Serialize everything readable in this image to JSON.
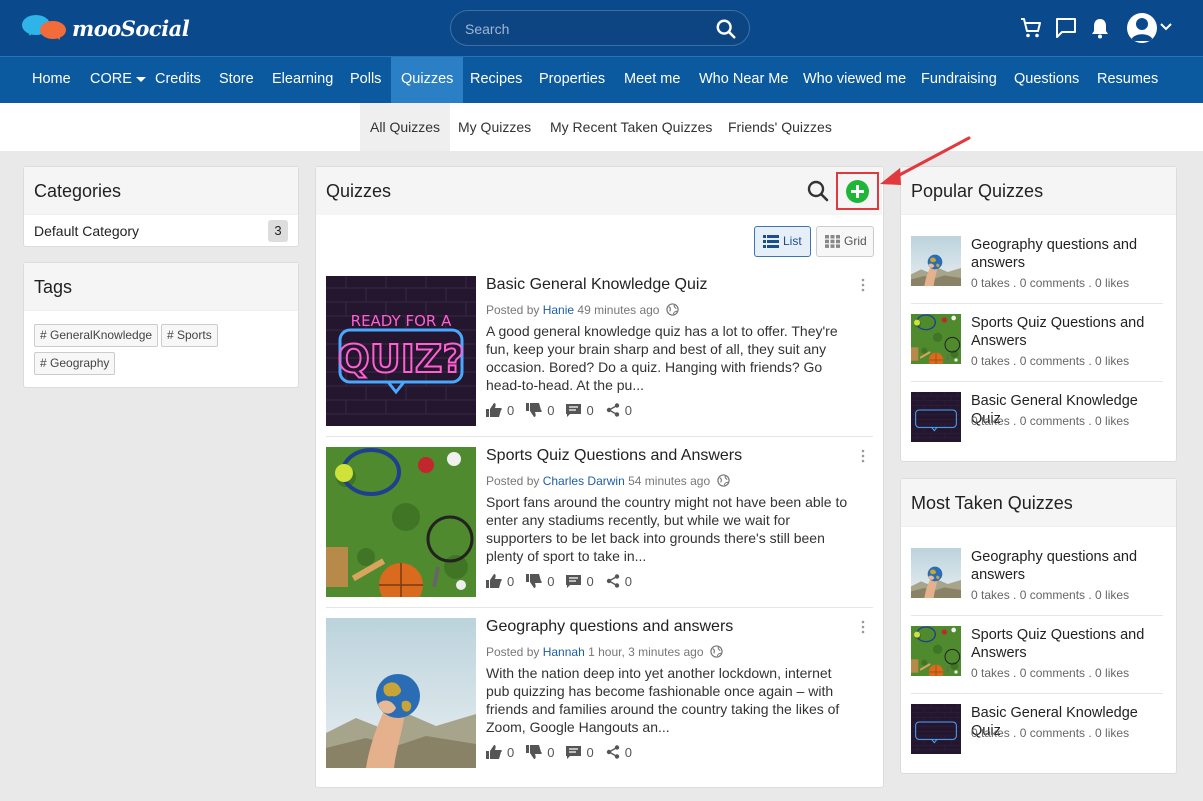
{
  "header": {
    "logo_text": "mooSocial",
    "search_placeholder": "Search"
  },
  "nav": {
    "items": [
      "Home",
      "CORE",
      "Credits",
      "Store",
      "Elearning",
      "Polls",
      "Quizzes",
      "Recipes",
      "Properties",
      "Meet me",
      "Who Near Me",
      "Who viewed me",
      "Fundraising",
      "Questions",
      "Resumes"
    ],
    "active": "Quizzes"
  },
  "subnav": {
    "items": [
      "All Quizzes",
      "My Quizzes",
      "My Recent Taken Quizzes",
      "Friends' Quizzes"
    ],
    "active": "All Quizzes"
  },
  "categories": {
    "title": "Categories",
    "items": [
      {
        "label": "Default Category",
        "count": "3"
      }
    ]
  },
  "tags": {
    "title": "Tags",
    "items": [
      "# GeneralKnowledge",
      "# Sports",
      "# Geography"
    ]
  },
  "main": {
    "title": "Quizzes",
    "view_list": "List",
    "view_grid": "Grid",
    "quizzes": [
      {
        "title": "Basic General Knowledge Quiz",
        "posted_by": "Posted by",
        "author": "Hanie",
        "time": "49 minutes ago",
        "desc": "A good general knowledge quiz has a lot to offer. They're fun, keep your brain sharp and best of all, they suit any occasion. Bored? Do a quiz. Hanging with friends? Go head-to-head. At the pu...",
        "likes": "0",
        "dislikes": "0",
        "comments": "0",
        "shares": "0",
        "thumb_text_1": "READY FOR A",
        "thumb_text_2": "QUIZ?"
      },
      {
        "title": "Sports Quiz Questions and Answers",
        "posted_by": "Posted by",
        "author": "Charles Darwin",
        "time": "54 minutes ago",
        "desc": "Sport fans around the country might not have been able to enter any stadiums recently, but while we wait for supporters to be let back into grounds there's still been plenty of sport to take in...",
        "likes": "0",
        "dislikes": "0",
        "comments": "0",
        "shares": "0"
      },
      {
        "title": "Geography questions and answers",
        "posted_by": "Posted by",
        "author": "Hannah",
        "time": "1 hour, 3 minutes ago",
        "desc": "With the nation deep into yet another lockdown, internet pub quizzing has become fashionable once again – with friends and families around the country taking the likes of Zoom, Google Hangouts an...",
        "likes": "0",
        "dislikes": "0",
        "comments": "0",
        "shares": "0"
      }
    ]
  },
  "popular": {
    "title": "Popular Quizzes",
    "items": [
      {
        "title": "Geography questions and answers",
        "stats": "0 takes . 0 comments . 0 likes"
      },
      {
        "title": "Sports Quiz Questions and Answers",
        "stats": "0 takes . 0 comments . 0 likes"
      },
      {
        "title": "Basic General Knowledge Quiz",
        "stats": "0 takes . 0 comments . 0 likes"
      }
    ]
  },
  "most_taken": {
    "title": "Most Taken Quizzes",
    "items": [
      {
        "title": "Geography questions and answers",
        "stats": "0 takes . 0 comments . 0 likes"
      },
      {
        "title": "Sports Quiz Questions and Answers",
        "stats": "0 takes . 0 comments . 0 likes"
      },
      {
        "title": "Basic General Knowledge Quiz",
        "stats": "0 takes . 0 comments . 0 likes"
      }
    ]
  },
  "colors": {
    "header_bg": "#0a4a8c",
    "nav_bg": "#0b5a9f",
    "nav_active": "#2b7fc4",
    "add_button": "#1fb537",
    "highlight_annotation": "#e0393e",
    "link": "#1d5ea8"
  }
}
